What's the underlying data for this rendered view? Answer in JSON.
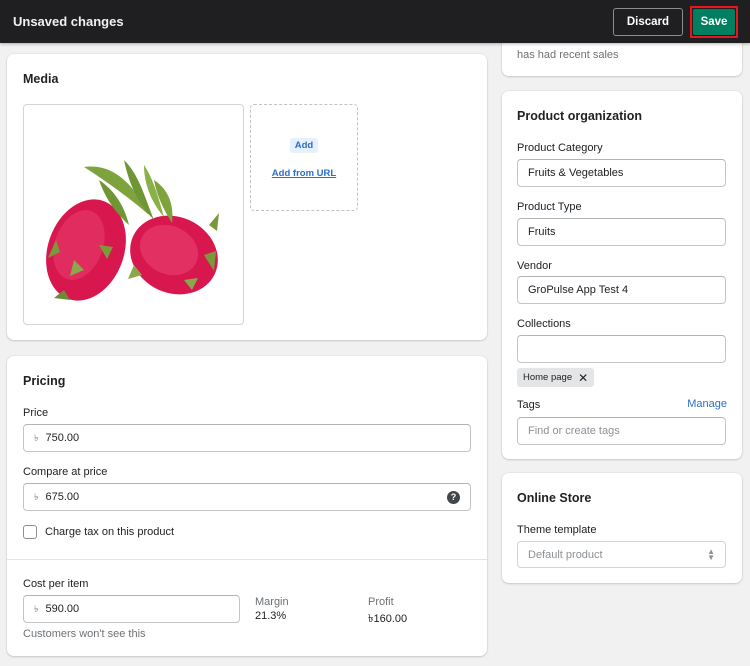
{
  "topbar": {
    "title": "Unsaved changes",
    "discard_label": "Discard",
    "save_label": "Save",
    "save_color": "#008060",
    "highlight_color": "#e8161c"
  },
  "media": {
    "title": "Media",
    "image_alt": "Dragon fruit product image",
    "add_label": "Add",
    "add_from_url_label": "Add from URL"
  },
  "pricing": {
    "title": "Pricing",
    "currency_symbol": "৳",
    "price": {
      "label": "Price",
      "value": "750.00"
    },
    "compare_at_price": {
      "label": "Compare at price",
      "value": "675.00",
      "help_icon": "question-circle-icon"
    },
    "charge_tax": {
      "label": "Charge tax on this product",
      "checked": false
    },
    "cost_per_item": {
      "label": "Cost per item",
      "value": "590.00",
      "note": "Customers won't see this"
    },
    "margin": {
      "label": "Margin",
      "value": "21.3%"
    },
    "profit": {
      "label": "Profit",
      "value": "৳160.00"
    }
  },
  "sidebar_top": {
    "partial_text": "has had recent sales"
  },
  "product_organization": {
    "title": "Product organization",
    "category": {
      "label": "Product Category",
      "value": "Fruits & Vegetables"
    },
    "type": {
      "label": "Product Type",
      "value": "Fruits"
    },
    "vendor": {
      "label": "Vendor",
      "value": "GroPulse App Test 4"
    },
    "collections": {
      "label": "Collections",
      "value": "",
      "chips": [
        "Home page"
      ]
    },
    "tags": {
      "label": "Tags",
      "manage_label": "Manage",
      "placeholder": "Find or create tags"
    }
  },
  "online_store": {
    "title": "Online Store",
    "theme_template": {
      "label": "Theme template",
      "value": "Default product"
    }
  }
}
